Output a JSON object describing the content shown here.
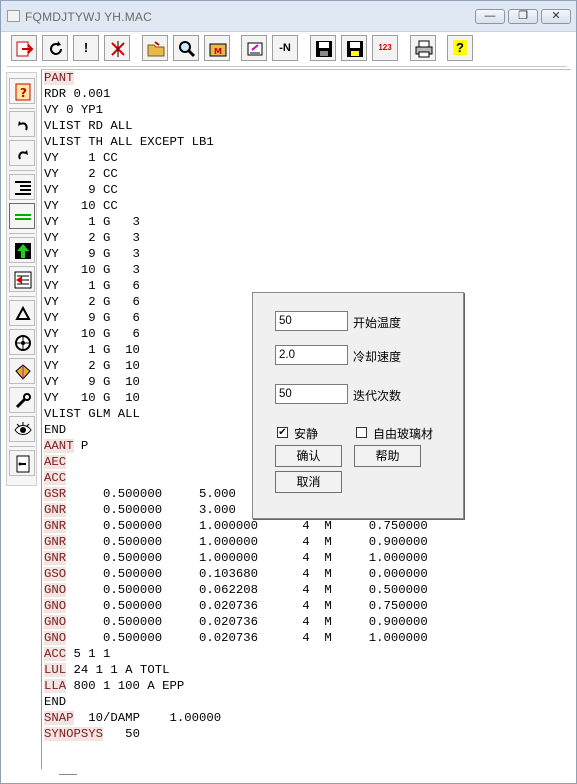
{
  "window": {
    "title": "FQMDJTYWJ YH.MAC",
    "minimize_glyph": "—",
    "restore_glyph": "❐",
    "close_glyph": "✕"
  },
  "toolbar": {
    "items": [
      {
        "icon": "exit-icon"
      },
      {
        "icon": "refresh-icon"
      },
      {
        "icon": "exclamation-icon",
        "glyph": "!"
      },
      {
        "icon": "stop-icon"
      },
      {
        "icon": "open-folder-icon"
      },
      {
        "icon": "magnifier-icon"
      },
      {
        "icon": "macro-icon"
      },
      {
        "icon": "edit-icon"
      },
      {
        "icon": "negate-icon",
        "glyph": "-N"
      },
      {
        "icon": "save-icon"
      },
      {
        "icon": "save-as-icon"
      },
      {
        "icon": "number-icon",
        "glyph": "123"
      },
      {
        "icon": "print-icon"
      },
      {
        "icon": "help-icon",
        "glyph": "?"
      }
    ]
  },
  "sidebar": {
    "items": [
      {
        "icon": "help-book-icon"
      },
      {
        "icon": "undo-icon"
      },
      {
        "icon": "redo-icon"
      },
      {
        "icon": "indent-icon"
      },
      {
        "icon": "lines-icon"
      },
      {
        "icon": "up-arrow-icon"
      },
      {
        "icon": "insert-icon"
      },
      {
        "icon": "triangle-icon"
      },
      {
        "icon": "target-icon"
      },
      {
        "icon": "lens-icon"
      },
      {
        "icon": "wrench-icon"
      },
      {
        "icon": "eye-icon"
      },
      {
        "icon": "exit-door-icon"
      }
    ]
  },
  "editor": {
    "lines": [
      {
        "kw": "PANT",
        "rest": ""
      },
      {
        "kw": "",
        "rest": "RDR 0.001"
      },
      {
        "kw": "",
        "rest": "VY 0 YP1"
      },
      {
        "kw": "",
        "rest": "VLIST RD ALL"
      },
      {
        "kw": "",
        "rest": "VLIST TH ALL EXCEPT LB1"
      },
      {
        "kw": "",
        "rest": "VY    1 CC"
      },
      {
        "kw": "",
        "rest": "VY    2 CC"
      },
      {
        "kw": "",
        "rest": "VY    9 CC"
      },
      {
        "kw": "",
        "rest": "VY   10 CC"
      },
      {
        "kw": "",
        "rest": "VY    1 G   3"
      },
      {
        "kw": "",
        "rest": "VY    2 G   3"
      },
      {
        "kw": "",
        "rest": "VY    9 G   3"
      },
      {
        "kw": "",
        "rest": "VY   10 G   3"
      },
      {
        "kw": "",
        "rest": "VY    1 G   6"
      },
      {
        "kw": "",
        "rest": "VY    2 G   6"
      },
      {
        "kw": "",
        "rest": "VY    9 G   6"
      },
      {
        "kw": "",
        "rest": "VY   10 G   6"
      },
      {
        "kw": "",
        "rest": "VY    1 G  10"
      },
      {
        "kw": "",
        "rest": "VY    2 G  10"
      },
      {
        "kw": "",
        "rest": "VY    9 G  10"
      },
      {
        "kw": "",
        "rest": "VY   10 G  10"
      },
      {
        "kw": "",
        "rest": "VLIST GLM ALL"
      },
      {
        "kw": "",
        "rest": "END"
      },
      {
        "kw": "AANT",
        "rest": " P"
      },
      {
        "kw": "AEC",
        "rest": ""
      },
      {
        "kw": "ACC",
        "rest": ""
      },
      {
        "kw": "GSR",
        "rest": "     0.500000     5.000"
      },
      {
        "kw": "GNR",
        "rest": "     0.500000     3.000"
      },
      {
        "kw": "GNR",
        "rest": "     0.500000     1.000000      4  M     0.750000"
      },
      {
        "kw": "GNR",
        "rest": "     0.500000     1.000000      4  M     0.900000"
      },
      {
        "kw": "GNR",
        "rest": "     0.500000     1.000000      4  M     1.000000"
      },
      {
        "kw": "GSO",
        "rest": "     0.500000     0.103680      4  M     0.000000"
      },
      {
        "kw": "GNO",
        "rest": "     0.500000     0.062208      4  M     0.500000"
      },
      {
        "kw": "GNO",
        "rest": "     0.500000     0.020736      4  M     0.750000"
      },
      {
        "kw": "GNO",
        "rest": "     0.500000     0.020736      4  M     0.900000"
      },
      {
        "kw": "GNO",
        "rest": "     0.500000     0.020736      4  M     1.000000"
      },
      {
        "kw": "ACC",
        "rest": " 5 1 1"
      },
      {
        "kw": "LUL",
        "rest": " 24 1 1 A TOTL"
      },
      {
        "kw": "LLA",
        "rest": " 800 1 100 A EPP"
      },
      {
        "kw": "",
        "rest": "END"
      },
      {
        "kw": "SNAP",
        "rest": "  10/DAMP    1.00000"
      },
      {
        "kw": "SYNOPSYS",
        "rest": "   50"
      }
    ]
  },
  "dialog": {
    "start_temp": {
      "value": "50",
      "label": "开始温度"
    },
    "cooling_rate": {
      "value": "2.0",
      "label": "冷却速度"
    },
    "iterations": {
      "value": "50",
      "label": "迭代次数"
    },
    "quiet": {
      "label": "安静",
      "checked": true
    },
    "free_glass": {
      "label": "自由玻璃材",
      "checked": false
    },
    "confirm_label": "确认",
    "help_label": "帮助",
    "cancel_label": "取消"
  }
}
